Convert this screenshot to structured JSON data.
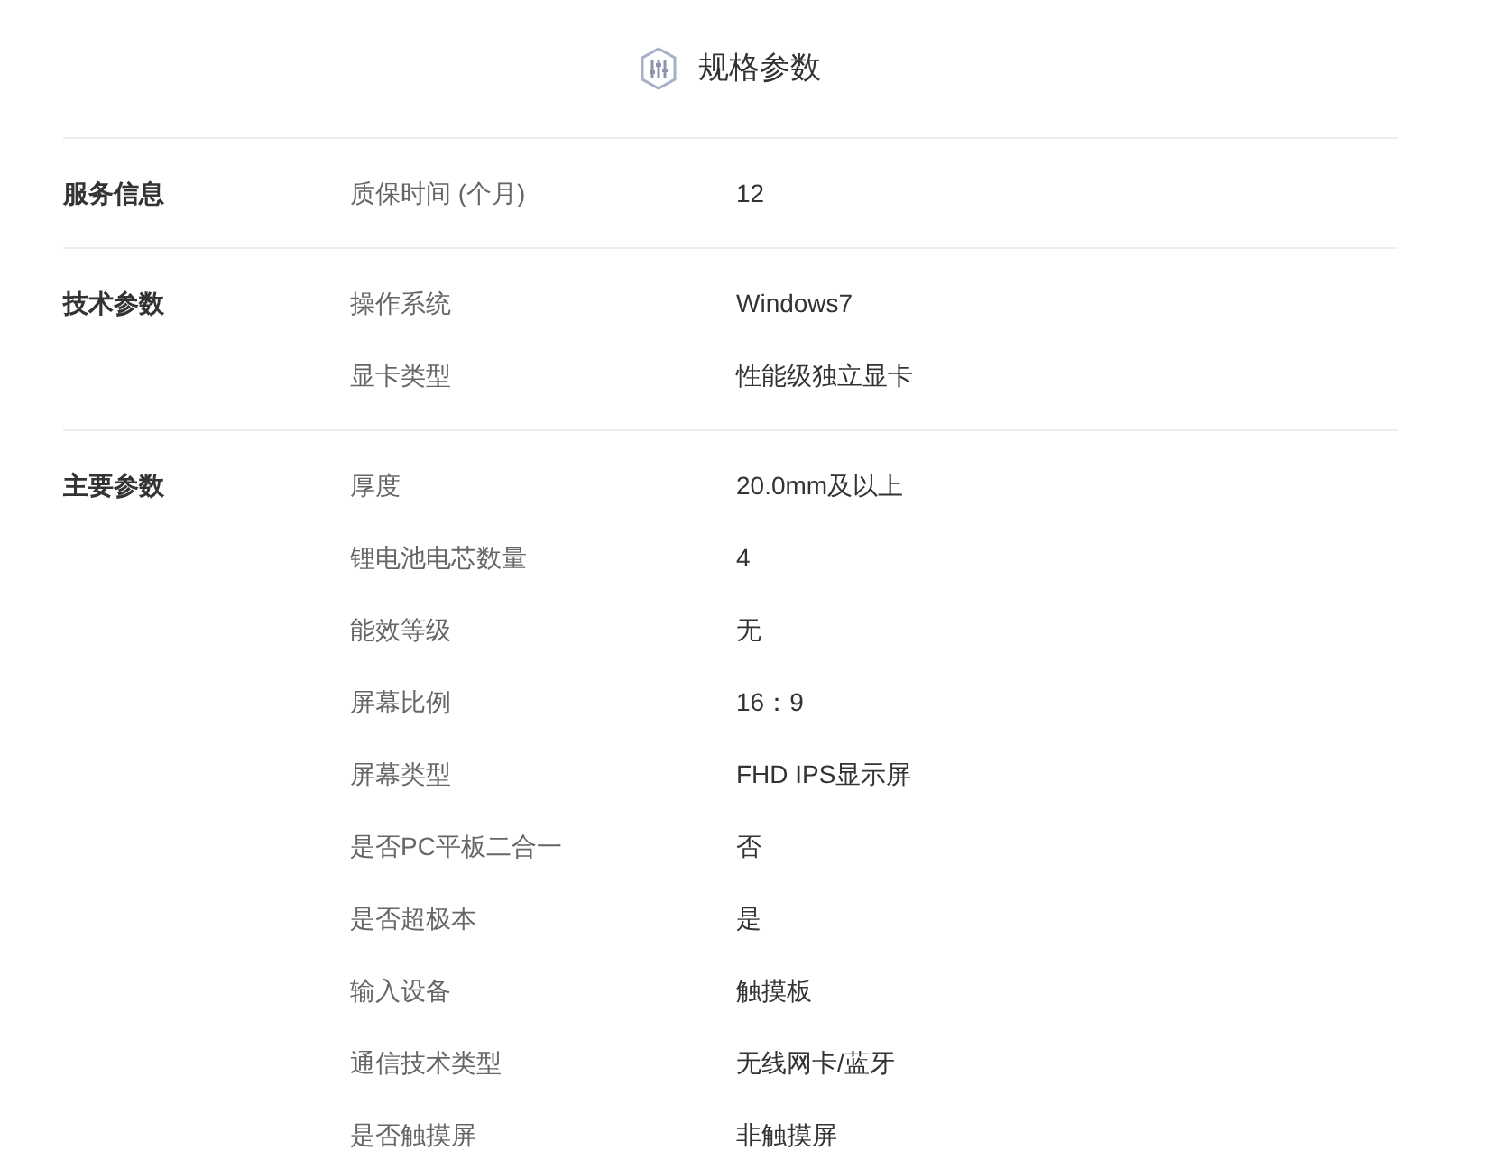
{
  "title": "规格参数",
  "groups": [
    {
      "name": "服务信息",
      "rows": [
        {
          "key": "质保时间 (个月)",
          "value": "12"
        }
      ]
    },
    {
      "name": "技术参数",
      "rows": [
        {
          "key": "操作系统",
          "value": "Windows7"
        },
        {
          "key": "显卡类型",
          "value": "性能级独立显卡"
        }
      ]
    },
    {
      "name": "主要参数",
      "rows": [
        {
          "key": "厚度",
          "value": "20.0mm及以上"
        },
        {
          "key": "锂电池电芯数量",
          "value": "4"
        },
        {
          "key": "能效等级",
          "value": "无"
        },
        {
          "key": "屏幕比例",
          "value": "16：9"
        },
        {
          "key": "屏幕类型",
          "value": "FHD IPS显示屏"
        },
        {
          "key": "是否PC平板二合一",
          "value": "否"
        },
        {
          "key": "是否超极本",
          "value": "是"
        },
        {
          "key": "输入设备",
          "value": "触摸板"
        },
        {
          "key": "通信技术类型",
          "value": "无线网卡/蓝牙"
        },
        {
          "key": "是否触摸屏",
          "value": "非触摸屏"
        }
      ]
    }
  ]
}
